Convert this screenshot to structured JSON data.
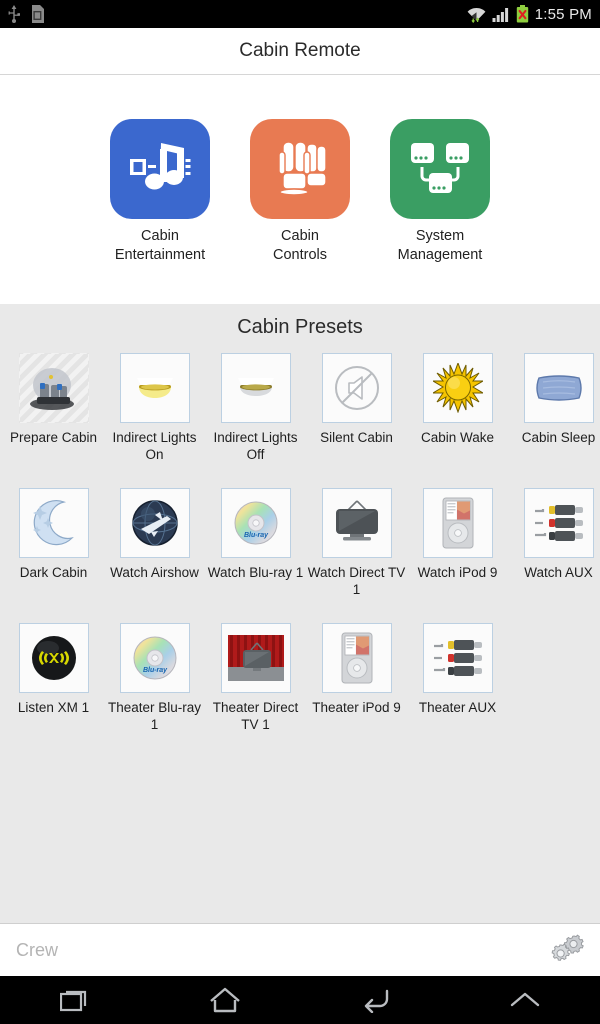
{
  "statusbar": {
    "time": "1:55 PM",
    "left_icons": [
      "usb-icon",
      "sd-card-icon"
    ],
    "right_icons": [
      "wifi-icon",
      "cellular-signal-icon",
      "battery-error-icon"
    ]
  },
  "header": {
    "title": "Cabin Remote"
  },
  "apps": [
    {
      "label": "Cabin\nEntertainment",
      "label_line1": "Cabin",
      "label_line2": "Entertainment",
      "color": "#3b68ce",
      "icon": "music-notes-icon"
    },
    {
      "label": "Cabin\nControls",
      "label_line1": "Cabin",
      "label_line2": "Controls",
      "color": "#e87a52",
      "icon": "cabin-seats-icon"
    },
    {
      "label": "System\nManagement",
      "label_line1": "System",
      "label_line2": "Management",
      "color": "#3a9e63",
      "icon": "network-nodes-icon"
    }
  ],
  "presets": {
    "title": "Cabin Presets",
    "items": [
      {
        "label": "Prepare Cabin",
        "icon": "prepare-cabin-icon",
        "state": "hatched"
      },
      {
        "label": "Indirect Lights On",
        "icon": "ceiling-light-on-icon",
        "state": "normal"
      },
      {
        "label": "Indirect Lights Off",
        "icon": "ceiling-light-off-icon",
        "state": "normal"
      },
      {
        "label": "Silent Cabin",
        "icon": "mute-speaker-icon",
        "state": "normal"
      },
      {
        "label": "Cabin Wake",
        "icon": "sun-icon",
        "state": "normal"
      },
      {
        "label": "Cabin Sleep",
        "icon": "pillow-icon",
        "state": "normal"
      },
      {
        "label": "Dark Cabin",
        "icon": "moon-stars-icon",
        "state": "normal"
      },
      {
        "label": "Watch Airshow",
        "icon": "airshow-globe-icon",
        "state": "normal"
      },
      {
        "label": "Watch Blu-ray 1",
        "icon": "bluray-disc-icon",
        "state": "normal"
      },
      {
        "label": "Watch Direct TV 1",
        "icon": "television-icon",
        "state": "normal"
      },
      {
        "label": "Watch iPod 9",
        "icon": "ipod-icon",
        "state": "normal"
      },
      {
        "label": "Watch AUX",
        "icon": "rca-cables-icon",
        "state": "normal"
      },
      {
        "label": "Listen XM 1",
        "icon": "xm-radio-icon",
        "state": "normal"
      },
      {
        "label": "Theater Blu-ray 1",
        "icon": "bluray-disc-icon",
        "state": "normal"
      },
      {
        "label": "Theater Direct TV 1",
        "icon": "theater-tv-icon",
        "state": "normal"
      },
      {
        "label": "Theater iPod 9",
        "icon": "ipod-icon",
        "state": "normal"
      },
      {
        "label": "Theater AUX",
        "icon": "rca-cables-icon",
        "state": "normal"
      }
    ]
  },
  "bottombar": {
    "crew_value": "",
    "crew_placeholder": "Crew",
    "settings_icon": "gears-icon"
  },
  "navbar": {
    "buttons": [
      {
        "name": "recents",
        "icon": "recents-icon"
      },
      {
        "name": "home",
        "icon": "home-icon"
      },
      {
        "name": "back",
        "icon": "back-icon"
      },
      {
        "name": "expand",
        "icon": "chevron-up-icon"
      }
    ]
  },
  "colors": {
    "panel_bg": "#e9e9e9",
    "tile_border": "#bcd0e2",
    "accent_blue": "#3b68ce",
    "accent_orange": "#e87a52",
    "accent_green": "#3a9e63"
  }
}
